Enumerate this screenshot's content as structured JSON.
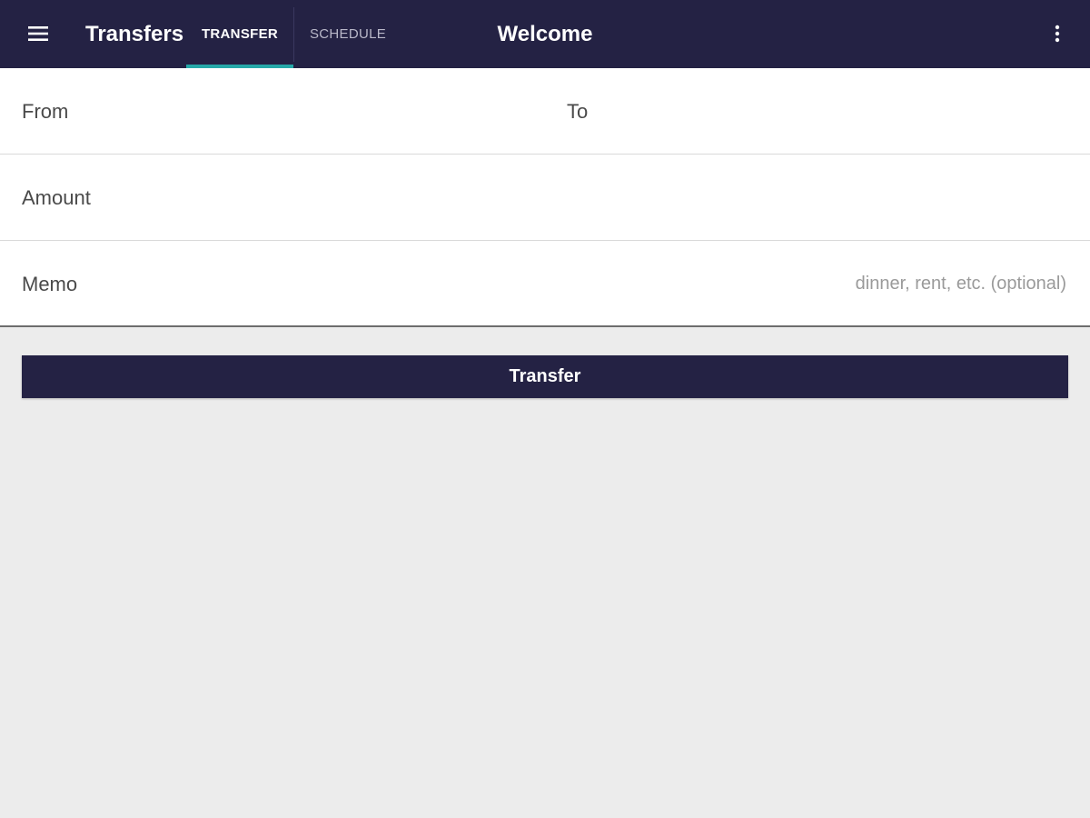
{
  "app_bar": {
    "title": "Transfers",
    "tabs": [
      {
        "label": "TRANSFER",
        "selected": true
      },
      {
        "label": "SCHEDULE",
        "selected": false
      }
    ],
    "welcome": "Welcome",
    "menu_icon": "hamburger-menu-icon",
    "overflow_icon": "more-vert-icon",
    "background_color": "#242244",
    "indicator_color": "#26a8a8"
  },
  "form": {
    "from": {
      "label": "From",
      "value": ""
    },
    "to": {
      "label": "To",
      "value": ""
    },
    "amount": {
      "label": "Amount",
      "value": ""
    },
    "memo": {
      "label": "Memo",
      "value": "",
      "placeholder": "dinner, rent, etc. (optional)"
    }
  },
  "actions": {
    "transfer_label": "Transfer"
  }
}
